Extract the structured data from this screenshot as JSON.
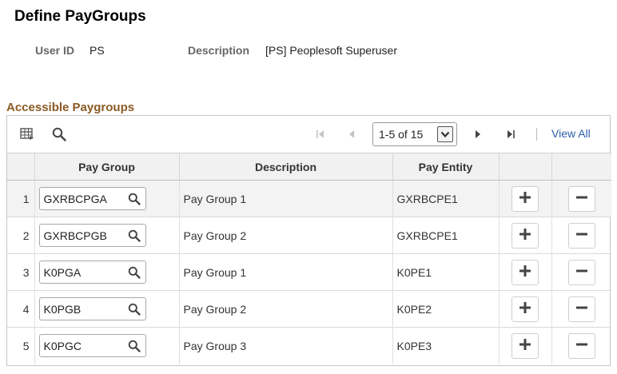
{
  "page": {
    "title": "Define PayGroups",
    "user_id_label": "User ID",
    "user_id_value": "PS",
    "description_label": "Description",
    "description_value": "[PS] Peoplesoft Superuser"
  },
  "grid": {
    "section_title": "Accessible Paygroups",
    "range_text": "1-5 of 15",
    "view_all": "View All",
    "columns": {
      "pay_group": "Pay Group",
      "description": "Description",
      "pay_entity": "Pay Entity"
    },
    "rows": [
      {
        "num": "1",
        "pay_group": "GXRBCPGA",
        "description": "Pay Group 1",
        "pay_entity": "GXRBCPE1"
      },
      {
        "num": "2",
        "pay_group": "GXRBCPGB",
        "description": "Pay Group 2",
        "pay_entity": "GXRBCPE1"
      },
      {
        "num": "3",
        "pay_group": "K0PGA",
        "description": "Pay Group 1",
        "pay_entity": "K0PE1"
      },
      {
        "num": "4",
        "pay_group": "K0PGB",
        "description": "Pay Group 2",
        "pay_entity": "K0PE2"
      },
      {
        "num": "5",
        "pay_group": "K0PGC",
        "description": "Pay Group 3",
        "pay_entity": "K0PE3"
      }
    ]
  },
  "icons": {
    "personalize": "grid-personalize-icon",
    "find": "search-icon",
    "first": "first-page-icon",
    "previous": "previous-page-icon",
    "next": "next-page-icon",
    "last": "last-page-icon",
    "lookup": "lookup-icon",
    "add": "plus-icon",
    "delete": "minus-icon"
  },
  "colors": {
    "section_title": "#8a5a24",
    "link": "#2b5fab",
    "header_bg": "#f1f1f1",
    "selected_row_bg": "#f3f3f3"
  }
}
